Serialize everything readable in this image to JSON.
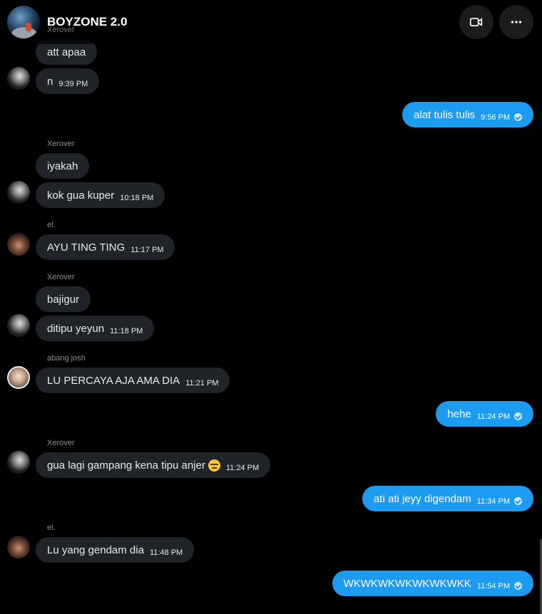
{
  "header": {
    "title": "BOYZONE 2.0",
    "partial_sender": "Xerover",
    "video_button": "video-icon",
    "more_button": "more-icon"
  },
  "accent_color": "#1d9bf0",
  "messages": [
    {
      "text": "att apaa",
      "time": ""
    },
    {
      "text": "n",
      "time": "9:39 PM"
    },
    {
      "text": "alat tulis tulis",
      "time": "9:56 PM"
    },
    {
      "sender": "Xerover"
    },
    {
      "text": "iyakah",
      "time": ""
    },
    {
      "text": "kok gua kuper",
      "time": "10:18 PM"
    },
    {
      "sender": "el."
    },
    {
      "text": "AYU TING TING",
      "time": "11:17 PM"
    },
    {
      "sender": "Xerover"
    },
    {
      "text": "bajigur",
      "time": ""
    },
    {
      "text": "ditipu yeyun",
      "time": "11:18 PM"
    },
    {
      "sender": "abang josh"
    },
    {
      "text": "LU PERCAYA AJA AMA DIA",
      "time": "11:21 PM"
    },
    {
      "text": "hehe",
      "time": "11:24 PM"
    },
    {
      "sender": "Xerover"
    },
    {
      "text": "gua lagi gampang kena tipu anjer",
      "time": "11:24 PM"
    },
    {
      "text": "ati ati jeyy digendam",
      "time": "11:34 PM"
    },
    {
      "sender": "el."
    },
    {
      "text": "Lu yang gendam dia",
      "time": "11:48 PM"
    },
    {
      "text": "WKWKWKWKWKWKWKK",
      "time": "11:54 PM"
    }
  ]
}
